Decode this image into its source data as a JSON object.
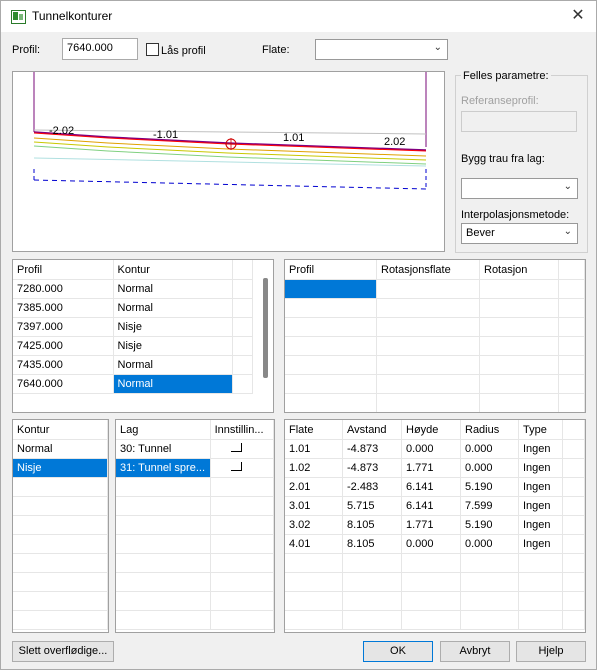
{
  "window": {
    "title": "Tunnelkonturer",
    "close_glyph": "✕"
  },
  "top": {
    "profil_label": "Profil:",
    "profil_value": "7640.000",
    "lock_label": "Lås profil",
    "flate_label": "Flate:",
    "flate_value": ""
  },
  "preview": {
    "labels": [
      "-2.02",
      "-1.01",
      "1.01",
      "2.02"
    ]
  },
  "params": {
    "group_title": "Felles parametre:",
    "ref_label": "Referanseprofil:",
    "ref_value": "",
    "bygg_label": "Bygg trau fra lag:",
    "bygg_value": "",
    "interp_label": "Interpolasjonsmetode:",
    "interp_value": "Bever"
  },
  "profile_table": {
    "headers": [
      "Profil",
      "Kontur"
    ],
    "rows": [
      [
        "7280.000",
        "Normal"
      ],
      [
        "7385.000",
        "Normal"
      ],
      [
        "7397.000",
        "Nisje"
      ],
      [
        "7425.000",
        "Nisje"
      ],
      [
        "7435.000",
        "Normal"
      ],
      [
        "7640.000",
        "Normal"
      ]
    ]
  },
  "rotation_table": {
    "headers": [
      "Profil",
      "Rotasjonsflate",
      "Rotasjon"
    ]
  },
  "kontur_table": {
    "headers": [
      "Kontur"
    ],
    "rows": [
      "Normal",
      "Nisje"
    ]
  },
  "lag_table": {
    "headers": [
      "Lag",
      "Innstillin..."
    ],
    "rows": [
      "30: Tunnel",
      "31: Tunnel spre..."
    ]
  },
  "flate_table": {
    "headers": [
      "Flate",
      "Avstand",
      "Høyde",
      "Radius",
      "Type"
    ],
    "rows": [
      [
        "1.01",
        "-4.873",
        "0.000",
        "0.000",
        "Ingen"
      ],
      [
        "1.02",
        "-4.873",
        "1.771",
        "0.000",
        "Ingen"
      ],
      [
        "2.01",
        "-2.483",
        "6.141",
        "5.190",
        "Ingen"
      ],
      [
        "3.01",
        "5.715",
        "6.141",
        "7.599",
        "Ingen"
      ],
      [
        "3.02",
        "8.105",
        "1.771",
        "5.190",
        "Ingen"
      ],
      [
        "4.01",
        "8.105",
        "0.000",
        "0.000",
        "Ingen"
      ]
    ]
  },
  "buttons": {
    "slett": "Slett overflødige...",
    "ok": "OK",
    "avbryt": "Avbryt",
    "hjelp": "Hjelp"
  },
  "colors": {
    "selection": "#0078d7"
  }
}
